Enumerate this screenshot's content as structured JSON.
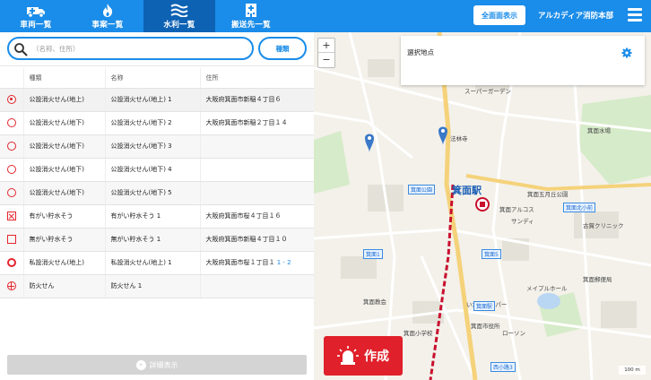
{
  "nav": {
    "tabs": [
      {
        "label": "車両一覧",
        "icon": "vehicle-icon",
        "active": false
      },
      {
        "label": "事案一覧",
        "icon": "fire-icon",
        "active": false
      },
      {
        "label": "水利一覧",
        "icon": "water-icon",
        "active": true
      },
      {
        "label": "搬送先一覧",
        "icon": "hospital-icon",
        "active": false
      }
    ],
    "fullscreen_label": "全面面表示",
    "station_name": "アルカディア消防本部"
  },
  "search": {
    "placeholder": "（名称、住所）",
    "value": "",
    "filter_label": "種類"
  },
  "table": {
    "headers": [
      "",
      "種類",
      "名称",
      "住所"
    ],
    "rows": [
      {
        "marker": "ring-dot",
        "type": "公設消火せん(地上)",
        "name": "公設消火せん(地上) 1",
        "address": "大阪府箕面市新稲４丁目６",
        "address_hl": ""
      },
      {
        "marker": "ring",
        "type": "公設消火せん(地下)",
        "name": "公設消火せん(地下) 2",
        "address": "大阪府箕面市新稲２丁目１４",
        "address_hl": ""
      },
      {
        "marker": "ring",
        "type": "公設消火せん(地下)",
        "name": "公設消火せん(地下) 3",
        "address": "",
        "address_hl": ""
      },
      {
        "marker": "ring",
        "type": "公設消火せん(地下)",
        "name": "公設消火せん(地下) 4",
        "address": "",
        "address_hl": ""
      },
      {
        "marker": "ring",
        "type": "公設消火せん(地下)",
        "name": "公設消火せん(地下) 5",
        "address": "",
        "address_hl": ""
      },
      {
        "marker": "square-x",
        "type": "有がい貯水そう",
        "name": "有がい貯水そう 1",
        "address": "大阪府箕面市桜４丁目１６",
        "address_hl": ""
      },
      {
        "marker": "square",
        "type": "無がい貯水そう",
        "name": "無がい貯水そう 1",
        "address": "大阪府箕面市新稲４丁目１０",
        "address_hl": ""
      },
      {
        "marker": "thick-ring",
        "type": "私設消火せん(地上)",
        "name": "私設消火せん(地上) 1",
        "address": "大阪府箕面市桜１丁目１",
        "address_hl": "1 - 2"
      },
      {
        "marker": "cross",
        "type": "防火せん",
        "name": "防火せん 1",
        "address": "",
        "address_hl": ""
      }
    ]
  },
  "detail_button_label": "詳細表示",
  "map": {
    "zoom_in": "+",
    "zoom_out": "−",
    "selected_panel_title": "選択地点",
    "create_button_label": "作成",
    "scale_label": "100 m",
    "station_label": "箕面駅",
    "labels": [
      {
        "text": "スーパーガーデン"
      },
      {
        "text": "箕面水場"
      },
      {
        "text": "法林寺"
      },
      {
        "text": "箕面アルコス"
      },
      {
        "text": "サンディ"
      },
      {
        "text": "箕面五月丘公園"
      },
      {
        "text": "メイプルホール"
      },
      {
        "text": "箕面郵便局"
      },
      {
        "text": "古賀クリニック"
      },
      {
        "text": "箕面小学校"
      },
      {
        "text": "箕面教会"
      },
      {
        "text": "ローソン"
      },
      {
        "text": "いかりスーパー"
      },
      {
        "text": "箕面市役所"
      }
    ],
    "badges": [
      {
        "text": "箕面公園"
      },
      {
        "text": "箕面北小前"
      },
      {
        "text": "箕面5"
      },
      {
        "text": "箕面1"
      },
      {
        "text": "箕面駅"
      },
      {
        "text": "西小路3"
      }
    ],
    "colors": {
      "road": "#ffffff",
      "main_road": "#f5d27a",
      "rail": "#c8102e",
      "pin": "#3a78c8",
      "water": "#b9d6f3",
      "park": "#d6ebc9"
    }
  }
}
